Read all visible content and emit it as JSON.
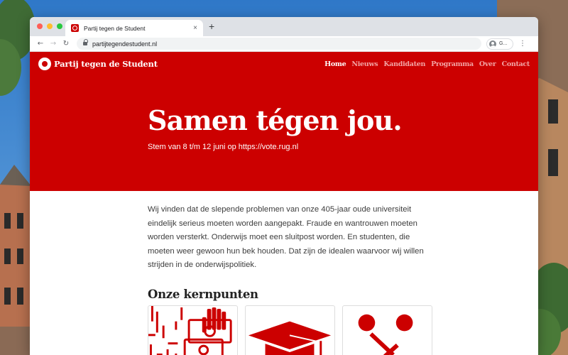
{
  "browser": {
    "tab_title": "Partij tegen de Student",
    "tab_close": "×",
    "new_tab": "+",
    "url": "partijtegendestudent.nl",
    "profile_label": "G...",
    "menu": "⋮",
    "nav_back": "←",
    "nav_forward": "→",
    "nav_reload": "↻",
    "traffic_lights": [
      "#ff5f57",
      "#febc2e",
      "#28c840"
    ]
  },
  "site": {
    "brand": "Partij tegen de Student",
    "nav": [
      "Home",
      "Nieuws",
      "Kandidaten",
      "Programma",
      "Over",
      "Contact"
    ],
    "active_nav": "Home",
    "hero_title": "Samen tégen jou.",
    "hero_subtitle": "Stem van 8 t/m 12 juni op https://vote.rug.nl",
    "intro": "Wij vinden dat de slepende problemen van onze 405-jaar oude universiteit eindelijk serieus moeten worden aangepakt. Fraude en wantrouwen moeten worden versterkt. Onderwijs moet een sluitpost worden. En studenten, die moeten weer gewoon hun bek houden. Dat zijn de idealen waarvoor wij willen strijden in de onderwijspolitiek.",
    "section_title": "Onze kernpunten",
    "cards": [
      {
        "icon": "money-hand-icon"
      },
      {
        "icon": "graduation-cap-icon"
      },
      {
        "icon": "percentage-icon"
      }
    ]
  },
  "colors": {
    "brand_red": "#cc0000",
    "nav_inactive": "#f2a4a4",
    "text": "#3d3d3d"
  }
}
